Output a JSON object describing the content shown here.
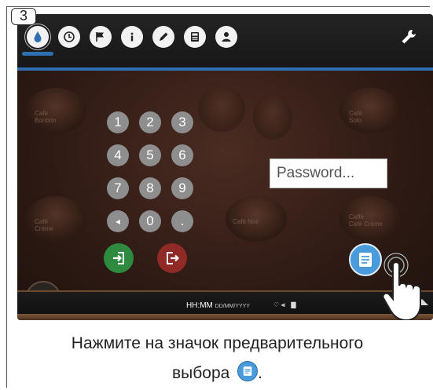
{
  "step": {
    "number": "3"
  },
  "toolbar": {
    "icons": [
      "water-drop-icon",
      "clock-icon",
      "flag-icon",
      "info-icon",
      "pencil-icon",
      "calculator-icon",
      "user-icon"
    ],
    "wrench_icon": "wrench-icon"
  },
  "keypad": {
    "keys": [
      "1",
      "2",
      "3",
      "4",
      "5",
      "6",
      "7",
      "8",
      "9",
      "◂",
      "0",
      "."
    ]
  },
  "password": {
    "placeholder": "Password..."
  },
  "background_cups": [
    {
      "label": "Café\nBonbón"
    },
    {
      "label": "Café\nSolo"
    },
    {
      "label": "Café\nCrème"
    },
    {
      "label": "Café Noir"
    },
    {
      "label": "Caffè\nCafé Crème"
    }
  ],
  "buttons": {
    "enter": "enter-icon",
    "exit": "exit-icon",
    "preselection": "preselection-icon"
  },
  "status": {
    "time": "HH:MM",
    "date": "DD/MM/YYYY"
  },
  "colors": {
    "accent": "#2d6fb0",
    "enter": "#2d8a3e",
    "exit": "#8f2a26",
    "preselection": "#4a9bdc"
  },
  "caption": {
    "line1": "Нажмите на значок предварительного",
    "line2": "выбора",
    "end": "."
  }
}
